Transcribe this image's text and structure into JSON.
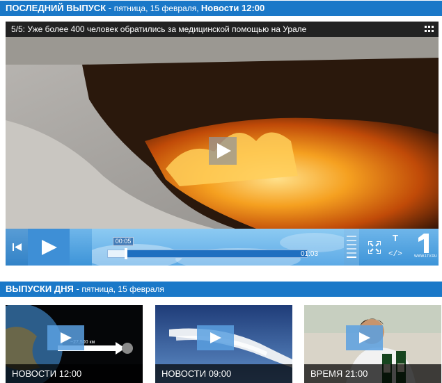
{
  "latest": {
    "title": "ПОСЛЕДНИЙ ВЫПУСК",
    "sep": " - ",
    "date": "пятница, 15 февраля, ",
    "edition": "Новости 12:00"
  },
  "player": {
    "video_title": "5/5: Уже более 400 человек обратились за медицинской помощью на Урале",
    "current_time": "00:05",
    "duration": "01:03",
    "progress": 0.09,
    "text_button": "T",
    "embed_button": "</>",
    "logo_url": "WWW.1TV.RU",
    "icons": {
      "menu": "grid-menu-icon",
      "play": "play-icon",
      "prev": "skip-back-icon",
      "fullscreen": "fullscreen-icon",
      "logo": "channel-one-logo"
    }
  },
  "day": {
    "title": "ВЫПУСКИ ДНЯ",
    "sep": " - ",
    "date": "пятница, 15 февраля"
  },
  "thumbnails": [
    {
      "caption": "НОВОСТИ 12:00",
      "annotation": "~27,500 км"
    },
    {
      "caption": "НОВОСТИ 09:00"
    },
    {
      "caption": "ВРЕМЯ 21:00"
    }
  ],
  "colors": {
    "accent": "#1a78c8",
    "control_bar": "#3d94d8"
  }
}
